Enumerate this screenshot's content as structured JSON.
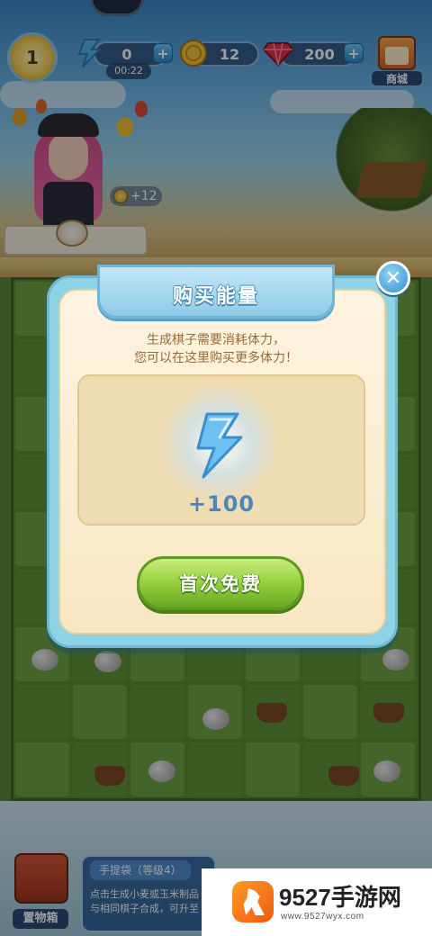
{
  "hud": {
    "level": "1",
    "energy": "0",
    "energy_timer": "00:22",
    "coins": "12",
    "gems": "200",
    "shop_label": "商城",
    "plus_symbol": "+"
  },
  "scene": {
    "coin_reward": "+12"
  },
  "bottom": {
    "basket_label": "置物箱",
    "info_title": "手提袋（等级4）",
    "info_text_line1": "点击生成小麦或玉米制品",
    "info_text_line2": "与相同棋子合成，可升至"
  },
  "dialog": {
    "title": "购买能量",
    "close_symbol": "✕",
    "description_line1": "生成棋子需要消耗体力，",
    "description_line2": "您可以在这里购买更多体力！",
    "reward_amount": "+100",
    "button_label": "首次免费"
  },
  "watermark": {
    "title": "9527手游网",
    "url": "www.9527wyx.com"
  },
  "colors": {
    "dialog_frame": "#8ed2e6",
    "dialog_body": "#fdf4e0",
    "button_green": "#8fcc3a",
    "amount_blue": "#4f86b8",
    "energy_blue": "#5aaeea"
  },
  "icons": [
    "level-badge-icon",
    "energy-bolt-icon",
    "gold-coin-icon",
    "red-gem-icon",
    "shop-store-icon",
    "close-icon",
    "basket-icon",
    "watermark-horse-logo"
  ]
}
